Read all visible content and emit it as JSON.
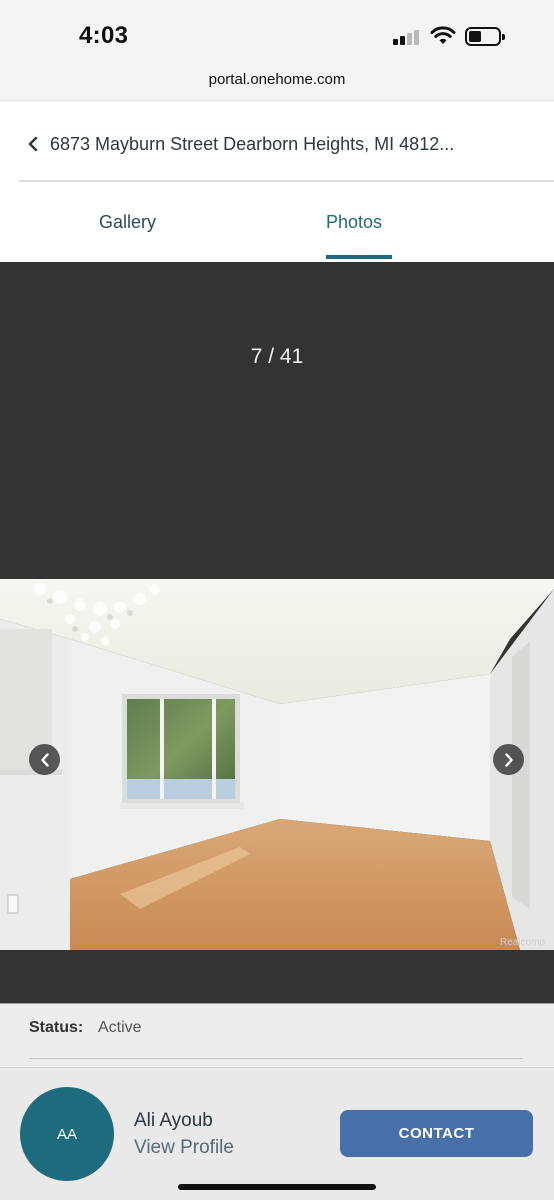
{
  "status_bar": {
    "time": "4:03",
    "url": "portal.onehome.com"
  },
  "header": {
    "address": "6873 Mayburn Street Dearborn Heights, MI 4812..."
  },
  "tabs": [
    {
      "label": "Gallery",
      "active": false
    },
    {
      "label": "Photos",
      "active": true
    }
  ],
  "viewer": {
    "counter": "7 / 41",
    "watermark": "Realcomp"
  },
  "details": {
    "status_label": "Status:",
    "status_value": "Active"
  },
  "agent": {
    "initials": "AA",
    "name": "Ali Ayoub",
    "profile_link": "View Profile",
    "contact_label": "CONTACT"
  },
  "colors": {
    "accent_teal": "#1d6b7c",
    "contact_blue": "#4870a8",
    "viewer_bg": "#333333"
  }
}
